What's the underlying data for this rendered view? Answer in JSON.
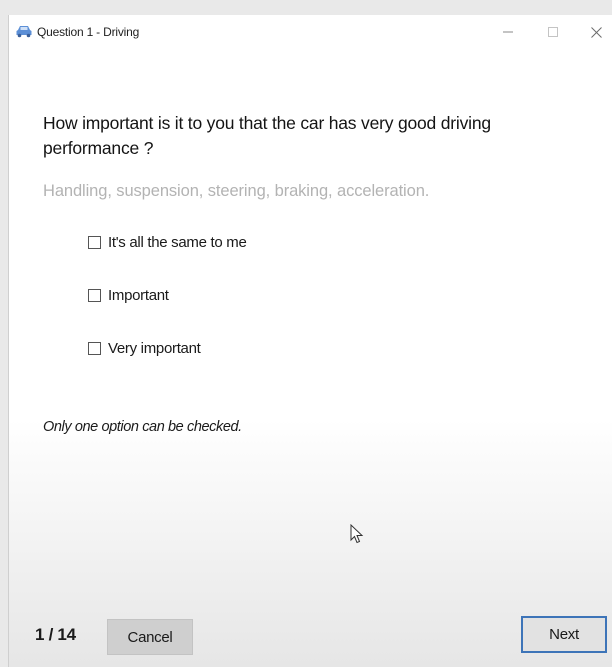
{
  "window": {
    "title": "Question 1 - Driving",
    "app_icon": "car-icon",
    "controls": {
      "minimize_glyph": "–",
      "maximize_glyph": "☐",
      "close_glyph": "X"
    }
  },
  "question": {
    "text": "How important is it to you that the car has very good driving performance ?",
    "subtitle": "Handling, suspension, steering, braking, acceleration."
  },
  "options": [
    {
      "label": "It's all the same to me",
      "checked": false
    },
    {
      "label": "Important",
      "checked": false
    },
    {
      "label": "Very important",
      "checked": false
    }
  ],
  "note": "Only one option can be checked.",
  "footer": {
    "progress": "1 / 14",
    "cancel_label": "Cancel",
    "next_label": "Next"
  },
  "colors": {
    "accent": "#3d74b8",
    "subtitle": "#b3b3b3"
  }
}
